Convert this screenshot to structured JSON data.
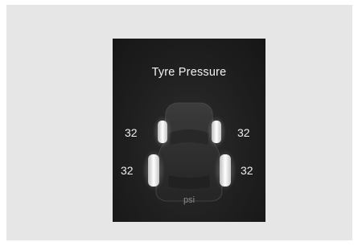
{
  "tpms": {
    "title": "Tyre Pressure",
    "unit": "psi",
    "front_left": "32",
    "front_right": "32",
    "rear_left": "32",
    "rear_right": "32"
  },
  "icons": {
    "car": "car-top-view-icon",
    "tyre": "tyre-icon"
  }
}
